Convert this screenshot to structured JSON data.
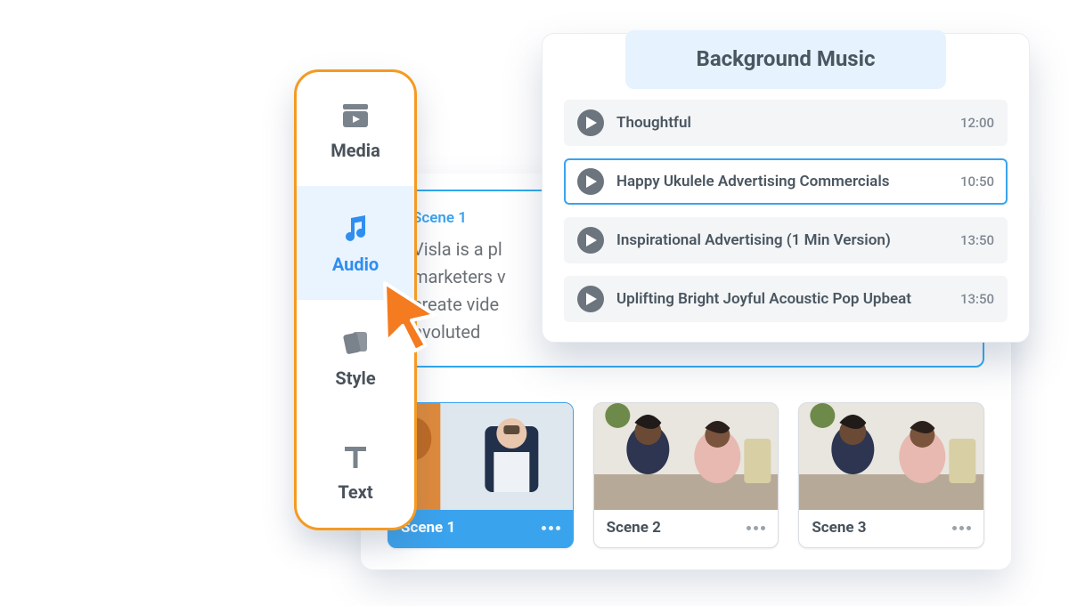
{
  "colors": {
    "accent_blue": "#3aa3ee",
    "accent_orange": "#f59a23",
    "text_muted": "#6b7075"
  },
  "toolbar": {
    "items": [
      {
        "id": "media",
        "label": "Media",
        "icon": "media-icon",
        "active": false
      },
      {
        "id": "audio",
        "label": "Audio",
        "icon": "music-note-icon",
        "active": true
      },
      {
        "id": "style",
        "label": "Style",
        "icon": "swatch-icon",
        "active": false
      },
      {
        "id": "text",
        "label": "Text",
        "icon": "text-icon",
        "active": false
      }
    ]
  },
  "scene_editor": {
    "current": {
      "title": "Scene 1",
      "description": "Visla is a pl\nmarketers v\ncreate vide\n nvoluted"
    },
    "scenes": [
      {
        "label": "Scene 1",
        "selected": true
      },
      {
        "label": "Scene 2",
        "selected": false
      },
      {
        "label": "Scene 3",
        "selected": false
      }
    ]
  },
  "music_panel": {
    "title": "Background Music",
    "tracks": [
      {
        "name": "Thoughtful",
        "duration": "12:00",
        "selected": false
      },
      {
        "name": "Happy Ukulele Advertising Commercials",
        "duration": "10:50",
        "selected": true
      },
      {
        "name": "Inspirational Advertising (1 Min Version)",
        "duration": "13:50",
        "selected": false
      },
      {
        "name": "Uplifting Bright Joyful Acoustic Pop Upbeat",
        "duration": "13:50",
        "selected": false
      }
    ]
  }
}
